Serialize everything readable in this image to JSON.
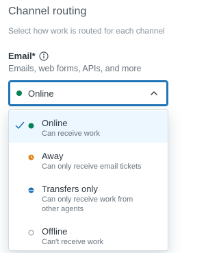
{
  "section": {
    "title": "Channel routing",
    "description": "Select how work is routed for each channel"
  },
  "email_field": {
    "label": "Email*",
    "hint": "Emails, web forms, APIs, and more",
    "selected_value": "Online",
    "selected_color": "#038153"
  },
  "options": [
    {
      "label": "Online",
      "description": "Can receive work",
      "icon": "online-dot-icon",
      "color": "#038153",
      "selected": true
    },
    {
      "label": "Away",
      "description": "Can only receive email tickets",
      "icon": "away-clock-icon",
      "color": "#e38215"
    },
    {
      "label": "Transfers only",
      "description_line1": "Can only receive work from",
      "description_line2": "other agents",
      "icon": "transfers-half-circle-icon",
      "color": "#1f73b7"
    },
    {
      "label": "Offline",
      "description": "Can't receive work",
      "icon": "offline-ring-icon",
      "color": "#87929d"
    }
  ],
  "accent_color": "#1f73b7"
}
